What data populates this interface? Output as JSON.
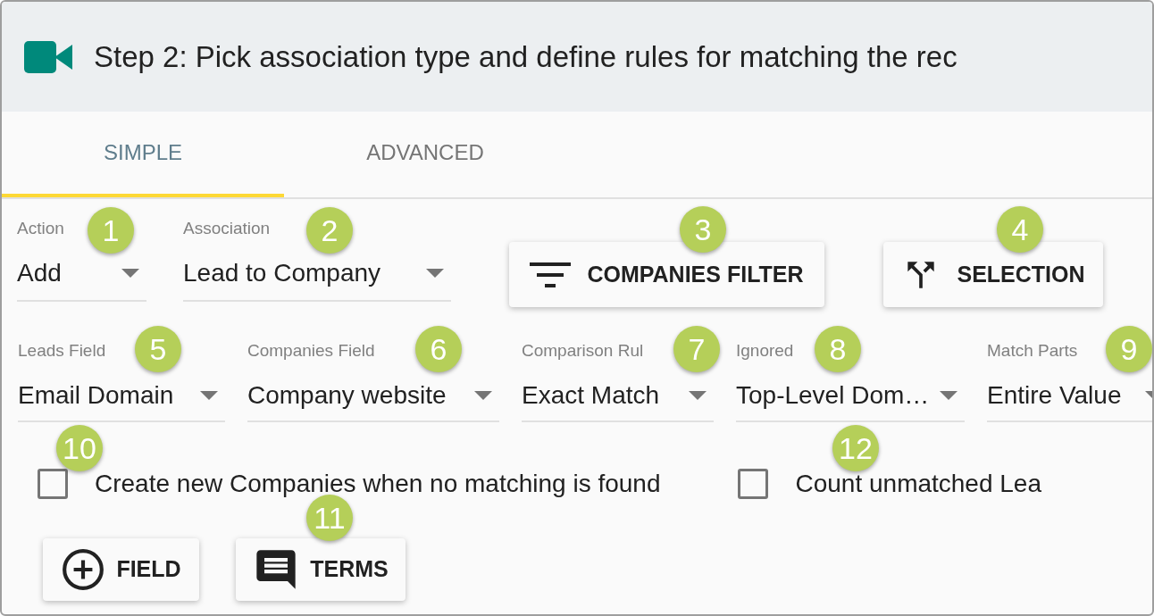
{
  "header": {
    "title": "Step 2: Pick association type and define rules for matching the rec"
  },
  "tabs": [
    {
      "label": "SIMPLE",
      "selected": true
    },
    {
      "label": "ADVANCED",
      "selected": false
    }
  ],
  "row_1": {
    "fields": [
      {
        "label": "Action",
        "value": "Add"
      },
      {
        "label": "Association",
        "value": "Lead to Company"
      }
    ],
    "buttons": [
      {
        "kind": "filter",
        "label": "COMPANIES FILTER"
      },
      {
        "kind": "split",
        "label": "SELECTION"
      }
    ]
  },
  "row_2": {
    "fields": [
      {
        "label": "Leads Field",
        "value": "Email Domain"
      },
      {
        "label": "Companies Field",
        "value": "Company website"
      },
      {
        "label": "Comparison Rul",
        "value": "Exact Match"
      },
      {
        "label": "Ignored",
        "value": "Top-Level Dom…"
      },
      {
        "label": "Match Parts",
        "value": "Entire Value"
      }
    ]
  },
  "checkboxes": [
    {
      "label": "Create new Companies when no matching is found",
      "checked": false
    },
    {
      "label": "Count unmatched Lea",
      "checked": false
    }
  ],
  "bottom_buttons": [
    {
      "kind": "add",
      "label": "FIELD"
    },
    {
      "kind": "comment",
      "label": "TERMS"
    }
  ],
  "callouts": [
    "1",
    "2",
    "3",
    "4",
    "5",
    "6",
    "7",
    "8",
    "9",
    "10",
    "11",
    "12"
  ]
}
